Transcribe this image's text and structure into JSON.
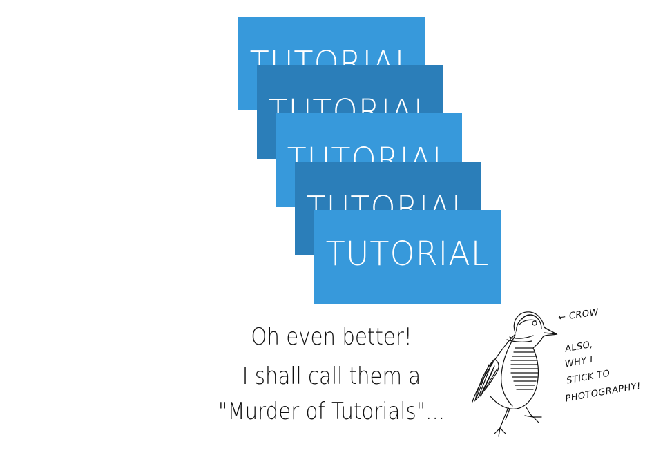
{
  "cards": [
    {
      "label": "TUTORIAL",
      "color": "#3799DB"
    },
    {
      "label": "TUTORIAL",
      "color": "#2B7EB9"
    },
    {
      "label": "TUTORIAL",
      "color": "#3799DB"
    },
    {
      "label": "TUTORIAL",
      "color": "#2B7EB9"
    },
    {
      "label": "TUTORIAL",
      "color": "#3799DB"
    }
  ],
  "caption": {
    "line1": "Oh even better!",
    "line2": "I shall call them a",
    "line3": "\"Murder of Tutorials\"..."
  },
  "annotations": {
    "crow_label": "← CROW",
    "also": "ALSO,",
    "why": "WHY I",
    "stick": "STICK TO",
    "photography": "PHOTOGRAPHY!"
  }
}
